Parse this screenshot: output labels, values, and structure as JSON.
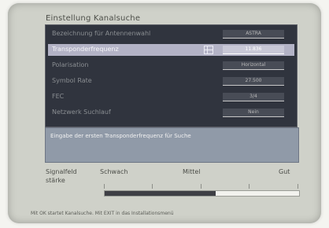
{
  "screen": {
    "title": "Einstellung Kanalsuche"
  },
  "menu": {
    "rows": [
      {
        "label": "Bezeichnung für Antennenwahl",
        "value": "ASTRA",
        "selected": false
      },
      {
        "label": "Transponderfrequenz",
        "value": "11.836",
        "selected": true
      },
      {
        "label": "Polarisation",
        "value": "Horizontal",
        "selected": false
      },
      {
        "label": "Symbol Rate",
        "value": "27.500",
        "selected": false
      },
      {
        "label": "FEC",
        "value": "3/4",
        "selected": false
      },
      {
        "label": "Netzwerk Suchlauf",
        "value": "Nein",
        "selected": false
      }
    ],
    "keypad_icon": "numeric-keypad-icon"
  },
  "help": {
    "text": "Eingabe der ersten Transponderfrequenz für Suche"
  },
  "signal": {
    "label_line1": "Signalfeld",
    "label_line2": "stärke",
    "scale_low": "Schwach",
    "scale_mid": "Mittel",
    "scale_high": "Gut",
    "level": 0.57
  },
  "footer": {
    "text": "Mit OK startet Kanalsuche. Mit EXIT in das Installationsmenü"
  },
  "colors": {
    "menu_bg": "#30343e",
    "selected_row": "#b3b3c6",
    "help_bg": "#909aa8",
    "signal_fill": "#3e3f45"
  }
}
